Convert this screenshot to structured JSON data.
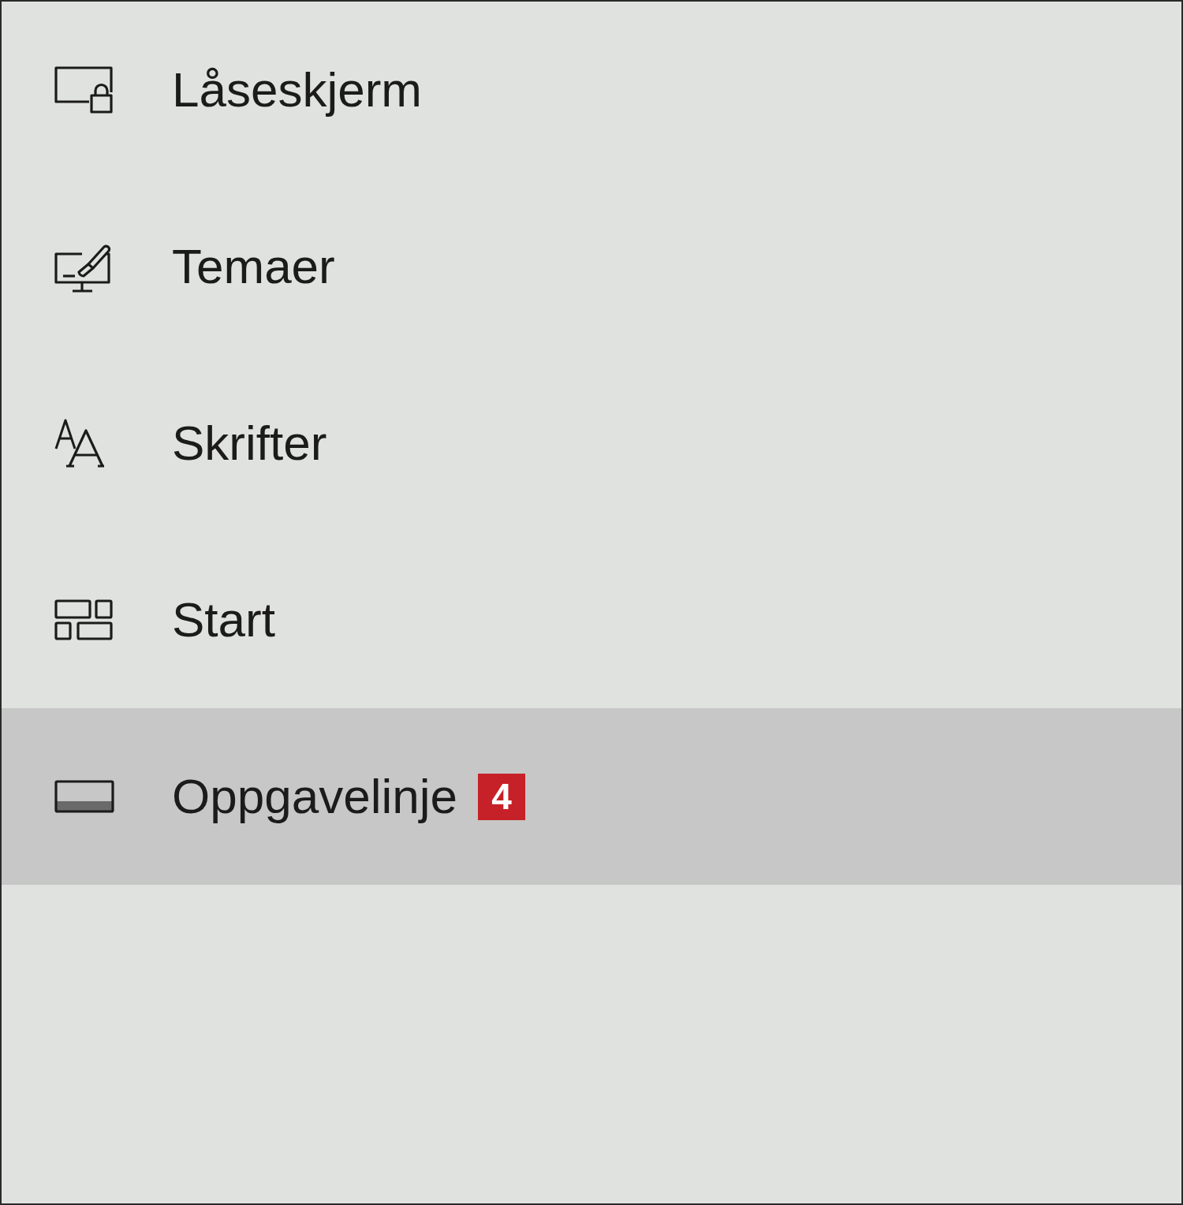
{
  "sidebar": {
    "items": [
      {
        "label": "Låseskjerm",
        "selected": false
      },
      {
        "label": "Temaer",
        "selected": false
      },
      {
        "label": "Skrifter",
        "selected": false
      },
      {
        "label": "Start",
        "selected": false
      },
      {
        "label": "Oppgavelinje",
        "selected": true,
        "badge": "4"
      }
    ]
  }
}
